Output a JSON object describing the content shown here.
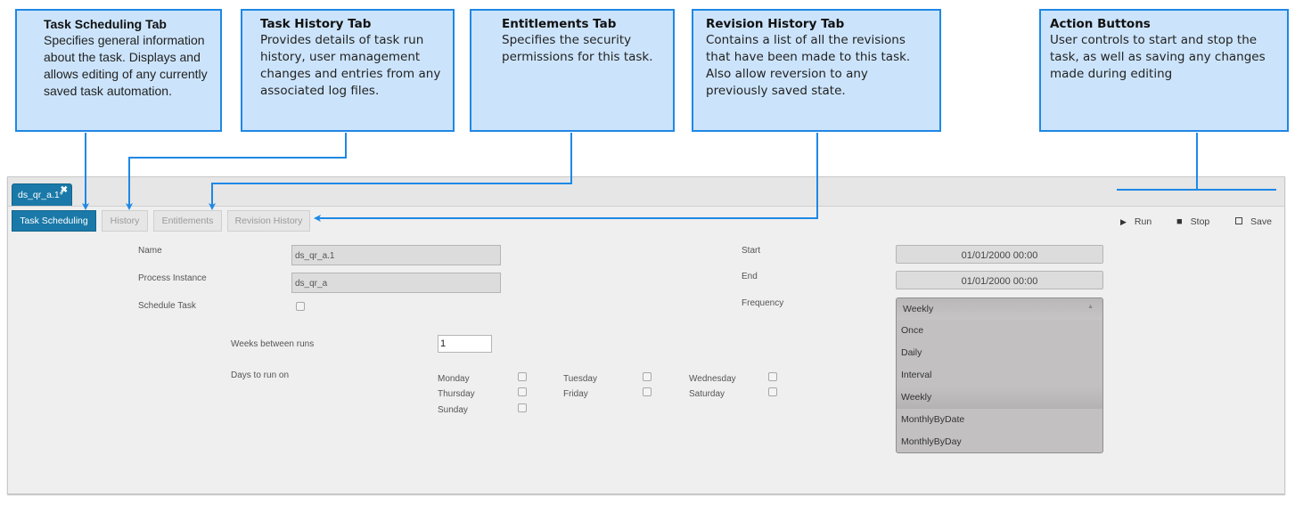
{
  "callouts": [
    {
      "title": "Task Scheduling Tab",
      "body": "Specifies general information about the task. Displays and allows editing of any currently saved task automation."
    },
    {
      "title": "Task History Tab",
      "body": "Provides details of task run history, user management changes and entries from any associated log files."
    },
    {
      "title": "Entitlements Tab",
      "body": "Specifies the security permissions for this task."
    },
    {
      "title": "Revision History Tab",
      "body": "Contains a list of all the revisions that have been made to this task. Also allow reversion to any previously saved state."
    },
    {
      "title": "Action Buttons",
      "body": "User controls to start and stop the task, as well as saving any changes made during editing"
    }
  ],
  "colors": {
    "accent": "#1a79a8",
    "callout_fill": "#cce4fb",
    "callout_border": "#1e88e5"
  },
  "document_tab": {
    "label": "ds_qr_a.1",
    "modified_marker": "*",
    "close_icon": "close-icon"
  },
  "tabs": [
    {
      "label": "Task Scheduling",
      "active": true
    },
    {
      "label": "History",
      "active": false
    },
    {
      "label": "Entitlements",
      "active": false
    },
    {
      "label": "Revision History",
      "active": false
    }
  ],
  "actions": [
    {
      "label": "Run",
      "icon": "play-icon",
      "glyph": "▶"
    },
    {
      "label": "Stop",
      "icon": "stop-icon",
      "glyph": "■"
    },
    {
      "label": "Save",
      "icon": "save-icon",
      "glyph": "🖫"
    }
  ],
  "form": {
    "name_label": "Name",
    "name_value": "ds_qr_a.1",
    "process_instance_label": "Process Instance",
    "process_instance_value": "ds_qr_a",
    "schedule_task_label": "Schedule Task",
    "schedule_task_checked": false,
    "weeks_between_runs_label": "Weeks between runs",
    "weeks_between_runs_value": "1",
    "days_to_run_on_label": "Days to run on",
    "days": [
      {
        "label": "Monday",
        "checked": false
      },
      {
        "label": "Tuesday",
        "checked": false
      },
      {
        "label": "Wednesday",
        "checked": false
      },
      {
        "label": "Thursday",
        "checked": false
      },
      {
        "label": "Friday",
        "checked": false
      },
      {
        "label": "Saturday",
        "checked": false
      },
      {
        "label": "Sunday",
        "checked": false
      }
    ],
    "start_label": "Start",
    "start_value": "01/01/2000 00:00",
    "end_label": "End",
    "end_value": "01/01/2000 00:00",
    "frequency_label": "Frequency",
    "frequency_value": "Weekly",
    "frequency_options": [
      "Once",
      "Daily",
      "Interval",
      "Weekly",
      "MonthlyByDate",
      "MonthlyByDay"
    ]
  }
}
